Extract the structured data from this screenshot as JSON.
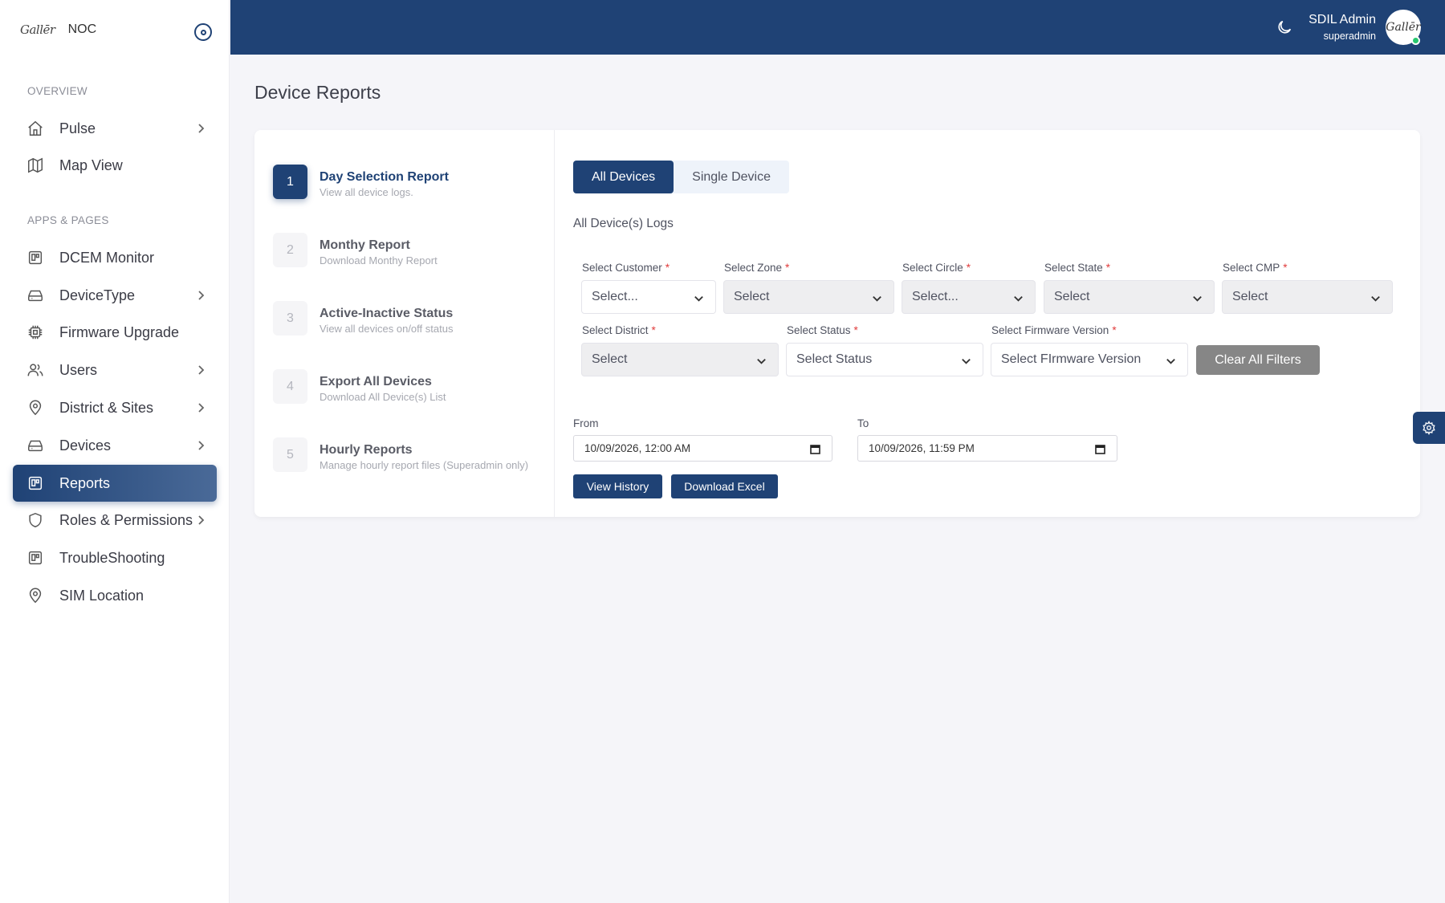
{
  "sidebar": {
    "brand_logo": "Gallēr",
    "brand_name": "NOC",
    "section_overview": "OVERVIEW",
    "section_apps": "APPS & PAGES",
    "items": [
      {
        "label": "Pulse",
        "icon": "home-icon"
      },
      {
        "label": "Map View",
        "icon": "map-icon"
      },
      {
        "label": "DCEM Monitor",
        "icon": "monitor-icon"
      },
      {
        "label": "DeviceType",
        "icon": "device-type-icon"
      },
      {
        "label": "Firmware Upgrade",
        "icon": "chip-icon"
      },
      {
        "label": "Users",
        "icon": "users-icon"
      },
      {
        "label": "District & Sites",
        "icon": "location-pin-icon"
      },
      {
        "label": "Devices",
        "icon": "devices-icon"
      },
      {
        "label": "Reports",
        "icon": "report-icon",
        "active": true
      },
      {
        "label": "Roles & Permissions",
        "icon": "shield-icon"
      },
      {
        "label": "TroubleShooting",
        "icon": "troubleshoot-icon"
      },
      {
        "label": "SIM Location",
        "icon": "location-pin-icon"
      }
    ]
  },
  "header": {
    "user_name": "SDIL Admin",
    "user_role": "superadmin",
    "avatar_text": "Gallēr",
    "accent_color": "#1f4275"
  },
  "page": {
    "title": "Device Reports"
  },
  "steps": [
    {
      "num": "1",
      "title": "Day Selection Report",
      "subtitle": "View all device logs.",
      "active": true
    },
    {
      "num": "2",
      "title": "Monthy Report",
      "subtitle": "Download Monthy Report"
    },
    {
      "num": "3",
      "title": "Active-Inactive Status",
      "subtitle": "View all devices on/off status"
    },
    {
      "num": "4",
      "title": "Export All Devices",
      "subtitle": "Download All Device(s) List"
    },
    {
      "num": "5",
      "title": "Hourly Reports",
      "subtitle": "Manage hourly report files (Superadmin only)"
    }
  ],
  "tabs": [
    {
      "label": "All Devices",
      "active": true
    },
    {
      "label": "Single Device"
    }
  ],
  "section_label": "All Device(s) Logs",
  "filters": {
    "customer": {
      "label": "Select Customer",
      "value": "Select..."
    },
    "zone": {
      "label": "Select Zone",
      "value": "Select"
    },
    "circle": {
      "label": "Select Circle",
      "value": "Select..."
    },
    "state": {
      "label": "Select State",
      "value": "Select"
    },
    "cmp": {
      "label": "Select CMP",
      "value": "Select"
    },
    "district": {
      "label": "Select District",
      "value": "Select"
    },
    "status": {
      "label": "Select Status",
      "value": "Select Status"
    },
    "firmware": {
      "label": "Select Firmware Version",
      "value": "Select FIrmware Version"
    },
    "required_mark": "*",
    "clear_label": "Clear All Filters"
  },
  "dates": {
    "from_label": "From",
    "from_value": "10/09/2026, 12:00  AM",
    "to_label": "To",
    "to_value": "10/09/2026, 11:59  PM"
  },
  "actions": {
    "view_history": "View History",
    "download_excel": "Download Excel"
  }
}
